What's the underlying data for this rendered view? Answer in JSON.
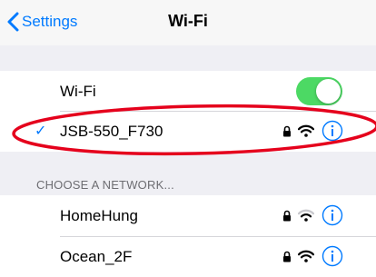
{
  "nav": {
    "back_label": "Settings",
    "title": "Wi-Fi"
  },
  "wifi_toggle": {
    "label": "Wi-Fi",
    "on": true
  },
  "connected": {
    "name": "JSB-550_F730",
    "check": "✓"
  },
  "section_header": "CHOOSE A NETWORK...",
  "networks": [
    {
      "name": "HomeHung",
      "secured": true
    },
    {
      "name": "Ocean_2F",
      "secured": true
    }
  ],
  "colors": {
    "accent": "#007aff",
    "toggle_on": "#4cd964",
    "annotation": "#e5001c"
  },
  "icons": [
    "chevron-left-icon",
    "lock-icon",
    "wifi-icon",
    "info-icon",
    "checkmark-icon"
  ]
}
